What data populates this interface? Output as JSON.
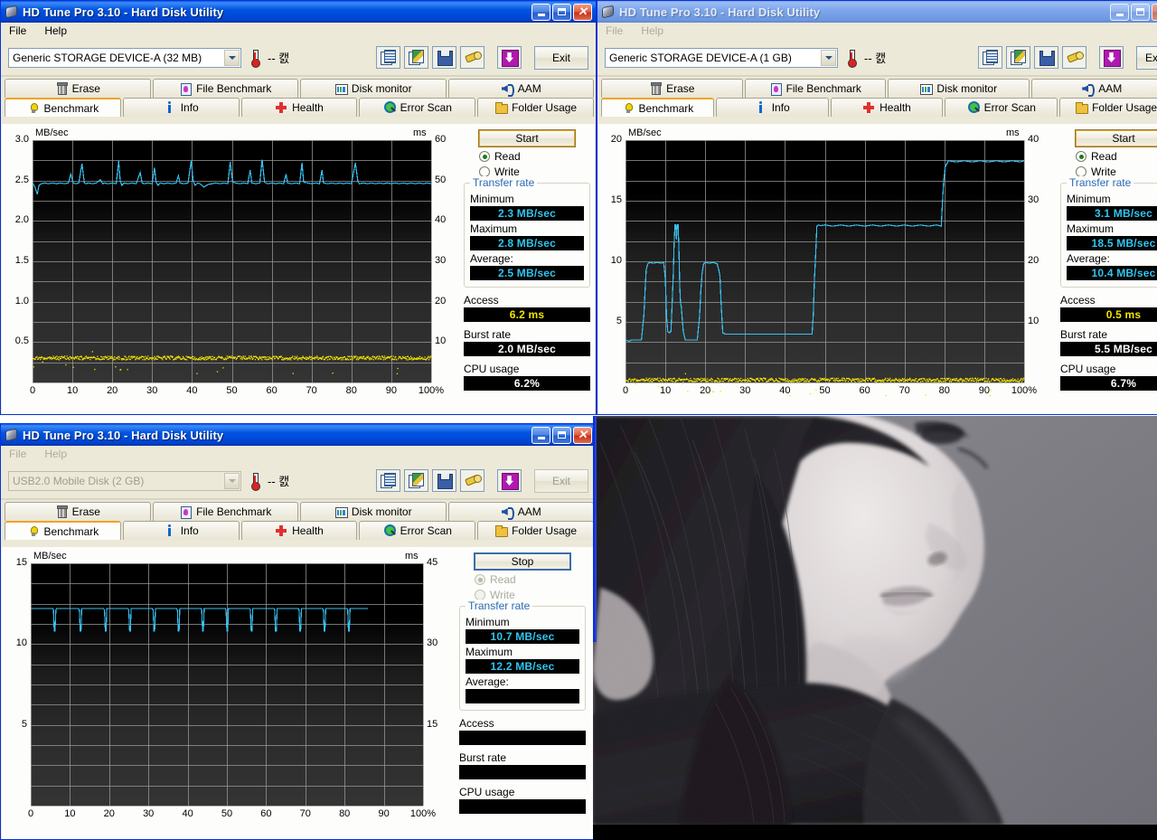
{
  "app": {
    "title": "HD Tune Pro 3.10 - Hard Disk Utility",
    "menu": {
      "file": "File",
      "help": "Help"
    },
    "temperature": "-- 캜",
    "exit_label": "Exit",
    "tabs_row1": [
      {
        "label": "Erase",
        "icon": "trash-icon"
      },
      {
        "label": "File Benchmark",
        "icon": "file-benchmark-icon"
      },
      {
        "label": "Disk monitor",
        "icon": "disk-monitor-icon"
      },
      {
        "label": "AAM",
        "icon": "speaker-icon"
      }
    ],
    "tabs_row2": [
      {
        "label": "Benchmark",
        "icon": "lightbulb-icon"
      },
      {
        "label": "Info",
        "icon": "info-icon"
      },
      {
        "label": "Health",
        "icon": "health-cross-icon"
      },
      {
        "label": "Error Scan",
        "icon": "magnifier-icon"
      },
      {
        "label": "Folder Usage",
        "icon": "folder-icon"
      }
    ],
    "toolbar_icons": [
      "copy-icon",
      "copy-color-icon",
      "save-icon",
      "wrench-icon",
      "download-icon"
    ],
    "panel_labels": {
      "read": "Read",
      "write": "Write",
      "transfer_rate": "Transfer rate",
      "minimum": "Minimum",
      "maximum": "Maximum",
      "average": "Average:",
      "access": "Access",
      "burst_rate": "Burst rate",
      "cpu_usage": "CPU usage"
    },
    "colors": {
      "read_line": "#38c0f0",
      "access_dots": "#f2e400",
      "accent_orange": "#f0a22a",
      "lcd_cyan": "#2fc6f0",
      "lcd_yellow": "#f2e400",
      "title_blue": "#0054e3"
    }
  },
  "window1": {
    "title": "HD Tune Pro 3.10 - Hard Disk Utility",
    "active": true,
    "device": "Generic STORAGE DEVICE-A (32 MB)",
    "start_label": "Start",
    "read_selected": true,
    "running": false,
    "stats": {
      "minimum": "2.3 MB/sec",
      "maximum": "2.8 MB/sec",
      "average": "2.5 MB/sec",
      "access": "6.2 ms",
      "burst": "2.0 MB/sec",
      "cpu": "6.2%"
    }
  },
  "window2": {
    "title": "HD Tune Pro 3.10 - Hard Disk Utility",
    "active": false,
    "device": "Generic STORAGE DEVICE-A (1 GB)",
    "start_label": "Start",
    "exit_label": "Ex",
    "read_selected": true,
    "running": false,
    "stats": {
      "minimum": "3.1 MB/sec",
      "maximum": "18.5 MB/sec",
      "average": "10.4 MB/sec",
      "access": "0.5 ms",
      "burst": "5.5 MB/sec",
      "cpu": "6.7%"
    }
  },
  "window3": {
    "title": "HD Tune Pro 3.10 - Hard Disk Utility",
    "active": true,
    "device": "USB2.0  Mobile Disk (2 GB)",
    "start_label": "Stop",
    "read_selected": true,
    "running": true,
    "stats": {
      "minimum": "10.7 MB/sec",
      "maximum": "12.2 MB/sec",
      "average": "",
      "access": "",
      "burst": "",
      "cpu": ""
    }
  },
  "photo": {
    "name": "black-and-white-portrait-photo",
    "description": "Black and white portrait of a woman in profile with long dark hair, wearing a dark knit sweater, looking down."
  },
  "chart_data": [
    {
      "id": "chart1",
      "type": "line",
      "title": "",
      "xlabel": "",
      "ylabel": "MB/sec",
      "y2label": "ms",
      "xlim": [
        0,
        100
      ],
      "ylim": [
        0,
        3.0
      ],
      "y2lim": [
        0,
        60
      ],
      "grid": true,
      "xticks": [
        0,
        10,
        20,
        30,
        40,
        50,
        60,
        70,
        80,
        90,
        100
      ],
      "xticklabels": [
        "0",
        "10",
        "20",
        "30",
        "40",
        "50",
        "60",
        "70",
        "80",
        "90",
        "100%"
      ],
      "yticks": [
        0.5,
        1.0,
        1.5,
        2.0,
        2.5,
        3.0
      ],
      "yticklabels": [
        "0.5",
        "1.0",
        "1.5",
        "2.0",
        "2.5",
        "3.0"
      ],
      "y2ticks": [
        10,
        20,
        30,
        40,
        50,
        60
      ],
      "y2ticklabels": [
        "10",
        "20",
        "30",
        "40",
        "50",
        "60"
      ],
      "series": [
        {
          "name": "Transfer rate",
          "color": "#38c0f0",
          "axis": "left",
          "x": [
            0,
            0.6,
            1.2,
            1.6,
            2.2,
            3,
            4,
            5,
            6,
            7,
            8,
            9,
            9.6,
            10.2,
            10.8,
            11.6,
            12.4,
            13,
            13.4,
            14,
            15,
            16,
            17,
            17.6,
            18,
            19,
            20,
            21,
            21.6,
            22,
            22.4,
            23,
            24,
            25,
            26,
            27,
            27.5,
            28,
            29,
            30,
            30.6,
            31,
            31.5,
            32,
            33,
            34,
            35,
            36,
            36.6,
            37,
            38,
            39,
            39.8,
            40.3,
            40.8,
            41.4,
            42,
            43,
            44,
            45,
            46,
            47,
            48,
            49,
            49.6,
            50.2,
            51,
            52,
            53,
            54,
            54.6,
            55,
            56,
            57,
            57.6,
            58.2,
            59,
            60,
            61,
            62,
            63,
            63.6,
            64,
            65,
            66,
            67,
            67.6,
            68,
            69,
            70,
            71,
            72,
            72.6,
            73,
            74,
            75,
            76,
            77,
            78,
            79,
            80,
            81,
            81.6,
            82,
            83,
            84,
            85,
            86,
            87,
            88,
            89,
            90,
            91,
            92,
            93,
            94,
            95,
            96,
            97,
            98,
            99,
            100
          ],
          "y": [
            2.47,
            2.42,
            2.33,
            2.44,
            2.46,
            2.47,
            2.46,
            2.47,
            2.46,
            2.47,
            2.46,
            2.47,
            2.58,
            2.47,
            2.46,
            2.47,
            2.71,
            2.47,
            2.46,
            2.47,
            2.46,
            2.47,
            2.51,
            2.46,
            2.47,
            2.46,
            2.47,
            2.46,
            2.74,
            2.5,
            2.44,
            2.47,
            2.46,
            2.47,
            2.46,
            2.6,
            2.47,
            2.46,
            2.47,
            2.46,
            2.66,
            2.48,
            2.44,
            2.47,
            2.46,
            2.47,
            2.46,
            2.47,
            2.56,
            2.47,
            2.46,
            2.47,
            2.74,
            2.5,
            2.44,
            2.47,
            2.46,
            2.42,
            2.45,
            2.46,
            2.47,
            2.46,
            2.47,
            2.46,
            2.73,
            2.48,
            2.47,
            2.46,
            2.47,
            2.46,
            2.63,
            2.47,
            2.46,
            2.47,
            2.76,
            2.48,
            2.46,
            2.47,
            2.46,
            2.47,
            2.46,
            2.58,
            2.47,
            2.46,
            2.47,
            2.46,
            2.72,
            2.48,
            2.47,
            2.46,
            2.47,
            2.46,
            2.63,
            2.47,
            2.46,
            2.47,
            2.46,
            2.47,
            2.46,
            2.47,
            2.46,
            2.72,
            2.49,
            2.46,
            2.47,
            2.46,
            2.47,
            2.46,
            2.47,
            2.46,
            2.47,
            2.46,
            2.47,
            2.46,
            2.47,
            2.46,
            2.47,
            2.46,
            2.47,
            2.46,
            2.47,
            2.46
          ]
        },
        {
          "name": "Access time",
          "color": "#f2e400",
          "axis": "right",
          "mode": "scatter",
          "mean_ms": 6.2
        }
      ]
    },
    {
      "id": "chart2",
      "type": "line",
      "title": "",
      "xlabel": "",
      "ylabel": "MB/sec",
      "y2label": "ms",
      "xlim": [
        0,
        100
      ],
      "ylim": [
        0,
        20
      ],
      "y2lim": [
        0,
        40
      ],
      "grid": true,
      "xticks": [
        0,
        10,
        20,
        30,
        40,
        50,
        60,
        70,
        80,
        90,
        100
      ],
      "xticklabels": [
        "0",
        "10",
        "20",
        "30",
        "40",
        "50",
        "60",
        "70",
        "80",
        "90",
        "100%"
      ],
      "yticks": [
        5,
        10,
        15,
        20
      ],
      "yticklabels": [
        "5",
        "10",
        "15",
        "20"
      ],
      "y2ticks": [
        10,
        20,
        30,
        40
      ],
      "y2ticklabels": [
        "10",
        "20",
        "30",
        "40"
      ],
      "series": [
        {
          "name": "Transfer rate",
          "color": "#38c0f0",
          "axis": "left",
          "x": [
            0,
            1,
            1.4,
            2,
            3,
            4,
            4.6,
            4.9,
            5.2,
            5.6,
            6,
            7,
            8,
            9,
            9.6,
            10,
            10.3,
            10.6,
            11,
            11.4,
            11.7,
            12,
            12.2,
            12.4,
            12.6,
            12.8,
            13,
            13.2,
            13.4,
            13.6,
            13.8,
            14,
            14.5,
            15,
            16,
            17,
            18,
            18.6,
            18.9,
            19.2,
            19.6,
            20,
            21,
            22,
            23,
            23.4,
            23.7,
            24,
            24.4,
            25,
            30,
            35,
            40,
            45,
            46.8,
            47.1,
            47.4,
            47.7,
            48,
            48.4,
            49,
            50,
            52,
            54,
            56,
            58,
            60,
            62,
            64,
            66,
            68,
            70,
            72,
            74,
            76,
            78,
            79.2,
            79.5,
            79.8,
            80.2,
            81,
            83,
            85,
            87,
            89,
            91,
            93,
            95,
            97,
            99,
            100
          ],
          "y": [
            3.5,
            3.4,
            3.5,
            3.5,
            3.5,
            3.5,
            5.5,
            7.5,
            9.3,
            9.8,
            9.9,
            9.85,
            9.9,
            9.85,
            9.9,
            8.5,
            5.5,
            4.2,
            4.1,
            4.2,
            6.5,
            9.0,
            11.5,
            13.0,
            13.0,
            11.8,
            13.0,
            13.0,
            11.0,
            8.0,
            6.5,
            6.3,
            4.2,
            3.5,
            3.5,
            3.5,
            3.5,
            5.5,
            7.5,
            9.0,
            9.8,
            9.9,
            9.85,
            9.9,
            9.8,
            9.3,
            8.8,
            6.5,
            4.1,
            4.0,
            4.0,
            4.0,
            4.0,
            4.0,
            4.0,
            5.5,
            8.5,
            10.6,
            12.9,
            13.0,
            12.95,
            13.0,
            12.9,
            13.0,
            12.9,
            13.0,
            12.9,
            13.0,
            12.9,
            13.0,
            12.9,
            13.0,
            12.9,
            13.0,
            12.9,
            13.0,
            12.9,
            14.8,
            16.5,
            17.8,
            18.3,
            18.2,
            18.3,
            18.2,
            18.3,
            18.2,
            18.3,
            18.2,
            18.3,
            18.2,
            18.3
          ]
        },
        {
          "name": "Access time",
          "color": "#f2e400",
          "axis": "right",
          "mode": "scatter",
          "mean_ms": 0.5
        }
      ]
    },
    {
      "id": "chart3",
      "type": "line",
      "title": "",
      "xlabel": "",
      "ylabel": "MB/sec",
      "y2label": "ms",
      "xlim": [
        0,
        100
      ],
      "ylim": [
        0,
        15
      ],
      "y2lim": [
        0,
        45
      ],
      "grid": true,
      "in_progress_until": 86,
      "xticks": [
        0,
        10,
        20,
        30,
        40,
        50,
        60,
        70,
        80,
        90,
        100
      ],
      "xticklabels": [
        "0",
        "10",
        "20",
        "30",
        "40",
        "50",
        "60",
        "70",
        "80",
        "90",
        "100%"
      ],
      "yticks": [
        5,
        10,
        15
      ],
      "yticklabels": [
        "5",
        "10",
        "15"
      ],
      "y2ticks": [
        15,
        30,
        45
      ],
      "y2ticklabels": [
        "15",
        "30",
        "45"
      ],
      "series": [
        {
          "name": "Transfer rate",
          "color": "#38c0f0",
          "axis": "left",
          "x": [
            0,
            5.6,
            5.8,
            6.0,
            6.2,
            6.4,
            6.6,
            12.2,
            12.4,
            12.6,
            12.8,
            13.0,
            18.6,
            18.8,
            19.0,
            19.2,
            19.4,
            24.8,
            25.0,
            25.2,
            25.4,
            25.6,
            31.0,
            31.2,
            31.4,
            31.6,
            31.8,
            37.2,
            37.4,
            37.6,
            37.8,
            38.0,
            43.4,
            43.6,
            43.8,
            44.0,
            44.2,
            49.6,
            49.8,
            50.0,
            50.2,
            50.4,
            55.8,
            56.0,
            56.2,
            56.4,
            56.6,
            62.0,
            62.2,
            62.4,
            62.6,
            62.8,
            68.2,
            68.4,
            68.6,
            68.8,
            69.0,
            74.4,
            74.6,
            74.8,
            75.0,
            75.2,
            80.6,
            80.8,
            81.0,
            81.2,
            81.4,
            86.0
          ],
          "y": [
            12.2,
            12.2,
            12.1,
            10.8,
            10.8,
            12.1,
            12.2,
            12.2,
            12.1,
            10.8,
            10.8,
            12.2,
            12.2,
            12.1,
            10.8,
            10.8,
            12.2,
            12.2,
            12.1,
            10.8,
            10.8,
            12.2,
            12.2,
            12.1,
            10.8,
            10.8,
            12.2,
            12.2,
            12.1,
            10.8,
            10.8,
            12.2,
            12.2,
            12.1,
            10.8,
            10.8,
            12.2,
            12.2,
            12.1,
            10.8,
            10.8,
            12.2,
            12.2,
            12.1,
            10.8,
            10.8,
            12.2,
            12.2,
            12.1,
            10.8,
            10.8,
            12.2,
            12.2,
            12.1,
            10.8,
            10.8,
            12.2,
            12.2,
            12.1,
            10.8,
            10.8,
            12.2,
            12.2,
            12.1,
            10.8,
            10.8,
            12.2,
            12.2
          ]
        }
      ]
    }
  ]
}
